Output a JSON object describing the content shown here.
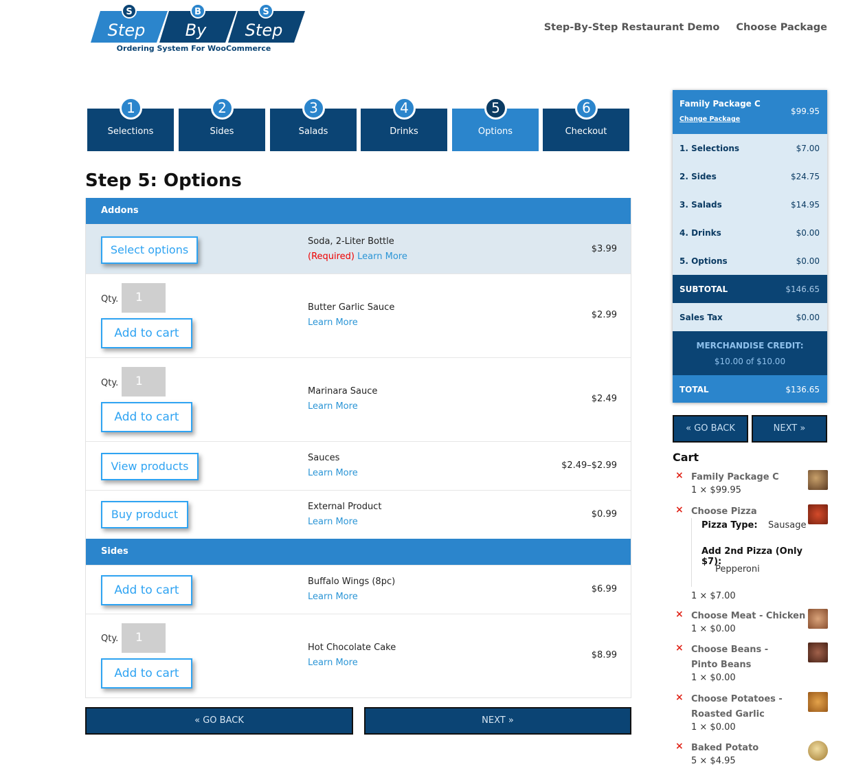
{
  "header": {
    "logo": {
      "word1": "Step",
      "word2": "By",
      "word3": "Step",
      "tagline": "Ordering System For WooCommerce",
      "badge1": "S",
      "badge2": "B",
      "badge3": "S"
    },
    "nav": [
      "Step-By-Step Restaurant Demo",
      "Choose Package"
    ]
  },
  "steps": [
    {
      "num": "1",
      "label": "Selections"
    },
    {
      "num": "2",
      "label": "Sides"
    },
    {
      "num": "3",
      "label": "Salads"
    },
    {
      "num": "4",
      "label": "Drinks"
    },
    {
      "num": "5",
      "label": "Options",
      "active": true
    },
    {
      "num": "6",
      "label": "Checkout"
    }
  ],
  "page_title": "Step 5: Options",
  "sections": {
    "addons": {
      "title": "Addons",
      "rows": [
        {
          "button": "Select options",
          "name": "Soda, 2-Liter Bottle",
          "required": "(Required)",
          "learn": "Learn More",
          "price": "$3.99"
        },
        {
          "qty_label": "Qty.",
          "qty": "1",
          "button": "Add to cart",
          "name": "Butter Garlic Sauce",
          "learn": "Learn More",
          "price": "$2.99"
        },
        {
          "qty_label": "Qty.",
          "qty": "1",
          "button": "Add to cart",
          "name": "Marinara Sauce",
          "learn": "Learn More",
          "price": "$2.49"
        },
        {
          "button": "View products",
          "name": "Sauces",
          "learn": "Learn More",
          "price": "$2.49–$2.99"
        },
        {
          "button": "Buy product",
          "name": "External Product",
          "learn": "Learn More",
          "price": "$0.99"
        }
      ]
    },
    "sides": {
      "title": "Sides",
      "rows": [
        {
          "button": "Add to cart",
          "name": "Buffalo Wings (8pc)",
          "learn": "Learn More",
          "price": "$6.99"
        },
        {
          "qty_label": "Qty.",
          "qty": "1",
          "button": "Add to cart",
          "name": "Hot Chocolate Cake",
          "learn": "Learn More",
          "price": "$8.99"
        }
      ]
    }
  },
  "bottom_nav": {
    "back": "« GO BACK",
    "next": "NEXT »"
  },
  "summary": {
    "package": "Family Package C",
    "package_price": "$99.95",
    "change": "Change Package",
    "lines": [
      {
        "label": "1. Selections",
        "value": "$7.00"
      },
      {
        "label": "2. Sides",
        "value": "$24.75"
      },
      {
        "label": "3. Salads",
        "value": "$14.95"
      },
      {
        "label": "4. Drinks",
        "value": "$0.00"
      },
      {
        "label": "5. Options",
        "value": "$0.00"
      }
    ],
    "subtotal_label": "SUBTOTAL",
    "subtotal": "$146.65",
    "tax_label": "Sales Tax",
    "tax": "$0.00",
    "credit_label": "MERCHANDISE CREDIT:",
    "credit": "$10.00 of $10.00",
    "total_label": "TOTAL",
    "total": "$136.65",
    "back": "« GO BACK",
    "next": "NEXT »"
  },
  "cart": {
    "title": "Cart",
    "items": [
      {
        "name": "Family Package C",
        "qty": "1 × $99.95"
      },
      {
        "name": "Choose Pizza",
        "meta1_key": "Pizza Type:",
        "meta1_val": "Sausage",
        "meta2_key": "Add 2nd Pizza (Only $7):",
        "meta2_val": "Pepperoni",
        "qty": "1 × $7.00"
      },
      {
        "name": "Choose Meat - Chicken",
        "qty": "1 × $0.00"
      },
      {
        "name": "Choose Beans - Pinto Beans",
        "qty": "1 × $0.00"
      },
      {
        "name": "Choose Potatoes - Roasted Garlic",
        "qty": "1 × $0.00"
      },
      {
        "name": "Baked Potato",
        "qty": "5 × $4.95"
      }
    ],
    "remove_glyph": "×"
  },
  "colors": {
    "primary": "#2b85cc",
    "dark": "#0b4474",
    "link": "#2ea3f2",
    "remove": "#e0261b"
  }
}
